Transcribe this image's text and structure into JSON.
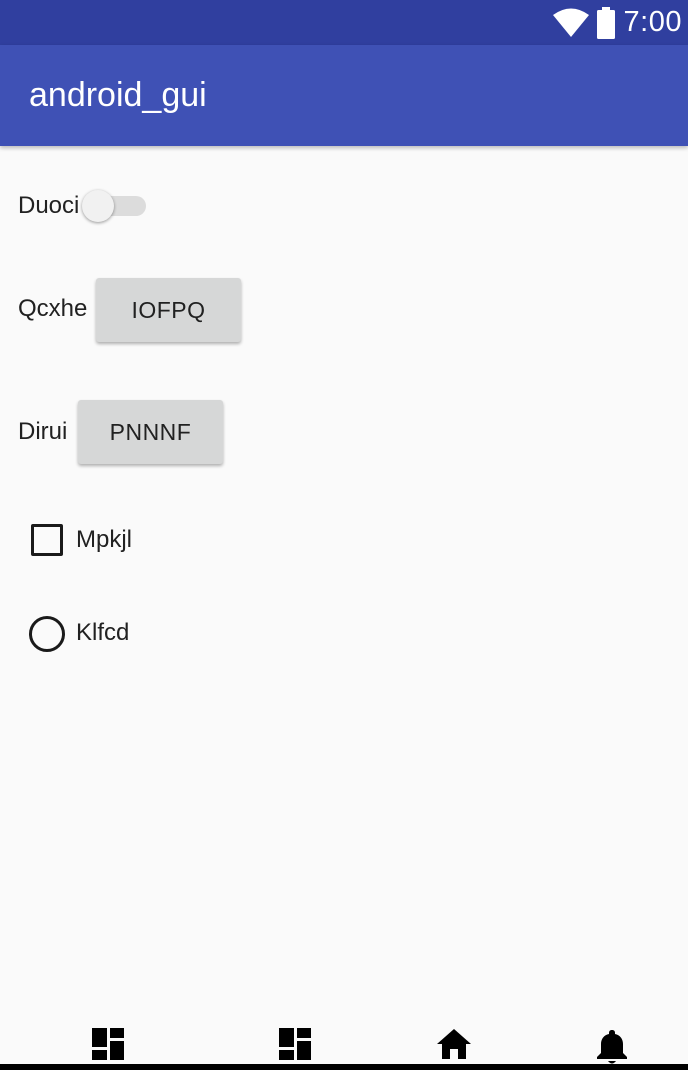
{
  "status_bar": {
    "time": "7:00",
    "icons": [
      "wifi-icon",
      "battery-icon"
    ]
  },
  "app_bar": {
    "title": "android_gui"
  },
  "form": {
    "switch_row": {
      "label": "Duoci",
      "checked": false
    },
    "button_row_1": {
      "label": "Qcxhe",
      "button": "IOFPQ"
    },
    "button_row_2": {
      "label": "Dirui",
      "button": "PNNNF"
    },
    "checkbox": {
      "label": "Mpkjl",
      "checked": false
    },
    "radio": {
      "label": "Klfcd",
      "checked": false
    }
  },
  "bottom_nav": {
    "items": [
      "dashboard-icon",
      "dashboard-icon",
      "home-icon",
      "notifications-icon"
    ]
  },
  "colors": {
    "status_bar": "#303f9f",
    "app_bar": "#3f51b5",
    "background": "#fafafa",
    "button": "#d6d7d7"
  }
}
